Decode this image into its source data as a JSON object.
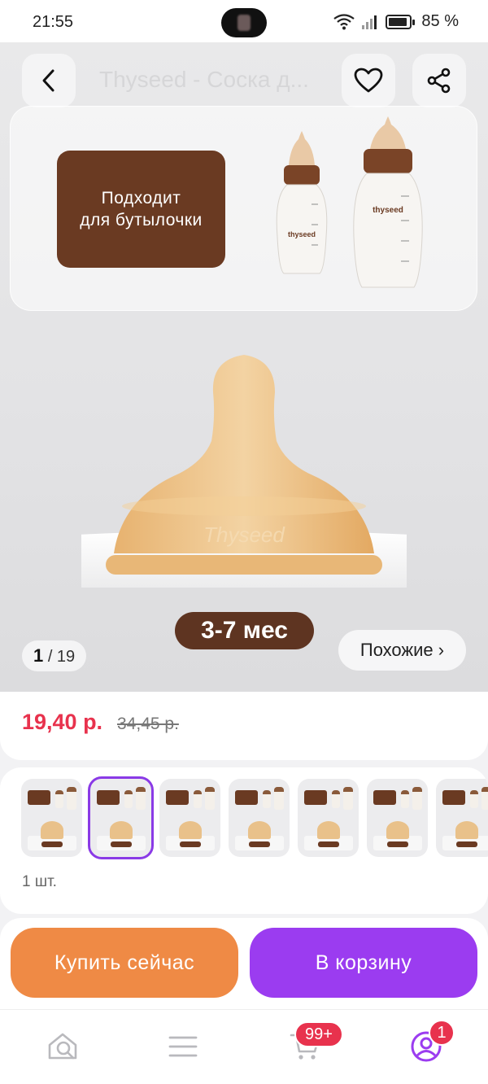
{
  "status_bar": {
    "time": "21:55",
    "battery": "85 %"
  },
  "header": {
    "title": "Thyseed - Соска д..."
  },
  "gallery": {
    "fit_label_line1": "Подходит",
    "fit_label_line2": "для бутылочки",
    "age_label": "3-7 мес",
    "page_current": "1",
    "page_total": "/ 19",
    "similar_label": "Похожие ›"
  },
  "price": {
    "current": "19,40 р.",
    "old": "34,45 р."
  },
  "variants": {
    "count": 7,
    "selected_index": 1,
    "quantity": "1 шт."
  },
  "actions": {
    "buy_now": "Купить сейчас",
    "add_to_cart": "В корзину"
  },
  "nav": {
    "cart_badge": "99+",
    "profile_badge": "1"
  },
  "colors": {
    "accent_purple": "#9b3cf0",
    "accent_orange": "#ef8a45",
    "price_red": "#e8324d",
    "brown": "#6a3a22"
  }
}
